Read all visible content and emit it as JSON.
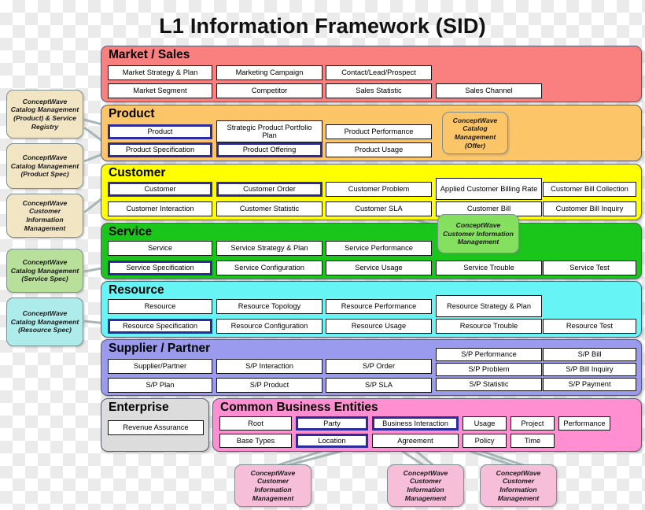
{
  "title": "L1 Information Framework (SID)",
  "bands": [
    {
      "id": "market",
      "title": "Market / Sales",
      "color": "#fa8080",
      "entities": [
        "Market Strategy & Plan",
        "Marketing Campaign",
        "Contact/Lead/Prospect",
        "Market Segment",
        "Competitor",
        "Sales Statistic",
        "Sales Channel"
      ]
    },
    {
      "id": "product",
      "title": "Product",
      "color": "#fcc668",
      "entities": [
        "Product",
        "Strategic Product Portfolio Plan",
        "Product Performance",
        "Product Specification",
        "Product Offering",
        "Product Usage"
      ]
    },
    {
      "id": "customer",
      "title": "Customer",
      "color": "#ffff00",
      "entities": [
        "Customer",
        "Customer Order",
        "Customer Problem",
        "Applied Customer Billing Rate",
        "Customer Bill Collection",
        "Customer Interaction",
        "Customer Statistic",
        "Customer SLA",
        "Customer Bill",
        "Customer Bill Inquiry"
      ]
    },
    {
      "id": "service",
      "title": "Service",
      "color": "#19c619",
      "entities": [
        "Service",
        "Service Strategy & Plan",
        "Service Performance",
        "Service Specification",
        "Service Configuration",
        "Service Usage",
        "Service Trouble",
        "Service Test"
      ]
    },
    {
      "id": "resource",
      "title": "Resource",
      "color": "#66f4f4",
      "entities": [
        "Resource",
        "Resource Topology",
        "Resource Performance",
        "Resource Strategy & Plan",
        "Resource Specification",
        "Resource Configuration",
        "Resource Usage",
        "Resource Trouble",
        "Resource Test"
      ]
    },
    {
      "id": "supplier",
      "title": "Supplier / Partner",
      "color": "#9a9aee",
      "entities": [
        "Supplier/Partner",
        "S/P Interaction",
        "S/P Order",
        "S/P Performance",
        "S/P Bill",
        "S/P Plan",
        "S/P Product",
        "S/P SLA",
        "S/P Problem",
        "S/P Bill Inquiry",
        "S/P Statistic",
        "S/P Payment"
      ]
    },
    {
      "id": "enterprise",
      "title": "Enterprise",
      "color": "#dcdcdc",
      "entities": [
        "Revenue Assurance"
      ]
    },
    {
      "id": "cbe",
      "title": "Common Business Entities",
      "color": "#ff8fd0",
      "entities": [
        "Root",
        "Party",
        "Business Interaction",
        "Usage",
        "Project",
        "Performance",
        "Base Types",
        "Location",
        "Agreement",
        "Policy",
        "Time"
      ]
    }
  ],
  "market": {
    "title": "Market / Sales",
    "e1": "Market Strategy & Plan",
    "e2": "Marketing Campaign",
    "e3": "Contact/Lead/Prospect",
    "e4": "Market Segment",
    "e5": "Competitor",
    "e6": "Sales Statistic",
    "e7": "Sales Channel"
  },
  "product": {
    "title": "Product",
    "e1": "Product",
    "e2": "Strategic Product Portfolio Plan",
    "e3": "Product Performance",
    "e4": "Product Specification",
    "e5": "Product Offering",
    "e6": "Product Usage"
  },
  "customer": {
    "title": "Customer",
    "e1": "Customer",
    "e2": "Customer Order",
    "e3": "Customer Problem",
    "e4": "Applied Customer Billing Rate",
    "e5": "Customer Bill Collection",
    "e6": "Customer Interaction",
    "e7": "Customer Statistic",
    "e8": "Customer SLA",
    "e9": "Customer Bill",
    "e10": "Customer Bill Inquiry"
  },
  "service": {
    "title": "Service",
    "e1": "Service",
    "e2": "Service Strategy & Plan",
    "e3": "Service Performance",
    "e4": "Service Specification",
    "e5": "Service Configuration",
    "e6": "Service Usage",
    "e7": "Service Trouble",
    "e8": "Service Test"
  },
  "resource": {
    "title": "Resource",
    "e1": "Resource",
    "e2": "Resource Topology",
    "e3": "Resource Performance",
    "e4": "Resource Strategy & Plan",
    "e5": "Resource Specification",
    "e6": "Resource Configuration",
    "e7": "Resource Usage",
    "e8": "Resource Trouble",
    "e9": "Resource Test"
  },
  "supplier": {
    "title": "Supplier / Partner",
    "e1": "Supplier/Partner",
    "e2": "S/P Interaction",
    "e3": "S/P Order",
    "e4": "S/P Performance",
    "e5": "S/P Bill",
    "e6": "S/P Plan",
    "e7": "S/P Product",
    "e8": "S/P SLA",
    "e9": "S/P Problem",
    "e10": "S/P Bill Inquiry",
    "e11": "S/P Statistic",
    "e12": "S/P Payment"
  },
  "enterprise": {
    "title": "Enterprise",
    "e1": "Revenue Assurance"
  },
  "cbe": {
    "title": "Common Business Entities",
    "e1": "Root",
    "e2": "Party",
    "e3": "Business Interaction",
    "e4": "Usage",
    "e5": "Project",
    "e6": "Performance",
    "e7": "Base Types",
    "e8": "Location",
    "e9": "Agreement",
    "e10": "Policy",
    "e11": "Time"
  },
  "callouts": {
    "c1": "ConceptWave Catalog Management (Product) & Service Registry",
    "c2": "ConceptWave Catalog Management (Product Spec)",
    "c3": "ConceptWave Customer Information Management",
    "c4": "ConceptWave Catalog Management (Service Spec)",
    "c5": "ConceptWave Catalog Management (Resource Spec)",
    "c6": "ConceptWave Catalog Management (Offer)",
    "c7": "ConceptWave Customer Information Management",
    "c8": "ConceptWave Customer Information Management",
    "c9": "ConceptWave Customer Information Management",
    "c10": "ConceptWave Customer Information Management"
  },
  "colors": {
    "market": "#fa8080",
    "product": "#fcc668",
    "customer": "#ffff00",
    "service": "#19c619",
    "resource": "#66f4f4",
    "supplier": "#9a9aee",
    "enterprise": "#dcdcdc",
    "cbe": "#ff8fd0",
    "highlight_border": "#2b2b9c",
    "callout_cream": "#f2e5c4",
    "callout_green": "#b9e09a",
    "callout_cyan": "#aeecec",
    "callout_pink": "#f6bed8"
  }
}
